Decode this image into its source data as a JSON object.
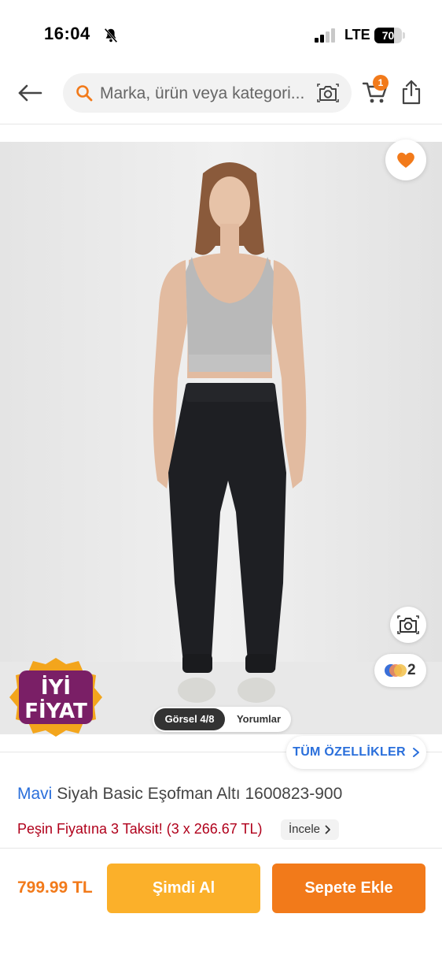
{
  "status_bar": {
    "time": "16:04",
    "network": "LTE",
    "battery_level": 70,
    "battery_label": "70",
    "icons": [
      "bell-slash-icon",
      "signal-icon",
      "battery-icon"
    ]
  },
  "nav": {
    "search_placeholder": "Marka, ürün veya kategori...",
    "cart_count": "1",
    "icons": [
      "back-arrow-icon",
      "search-icon",
      "camera-icon",
      "cart-icon",
      "share-icon"
    ]
  },
  "gallery": {
    "tab_gallery": "Görsel 4/8",
    "tab_reviews": "Yorumlar",
    "color_count": "2",
    "badge_line1": "İYİ",
    "badge_line2": "FİYAT",
    "all_features": "TÜM ÖZELLİKLER"
  },
  "product": {
    "brand": "Mavi",
    "name": "Siyah Basic Eşofman Altı 1600823-900",
    "installment": "Peşin Fiyatına 3 Taksit! (3 x 266.67 TL)",
    "inspect": "İncele",
    "price": "799.99 TL"
  },
  "actions": {
    "buy_now": "Şimdi Al",
    "add_to_cart": "Sepete Ekle"
  },
  "colors": {
    "accent": "#f27a1a",
    "buy_now": "#fbb02a",
    "brand_link": "#2a6fdb",
    "installment": "#b0001b"
  }
}
